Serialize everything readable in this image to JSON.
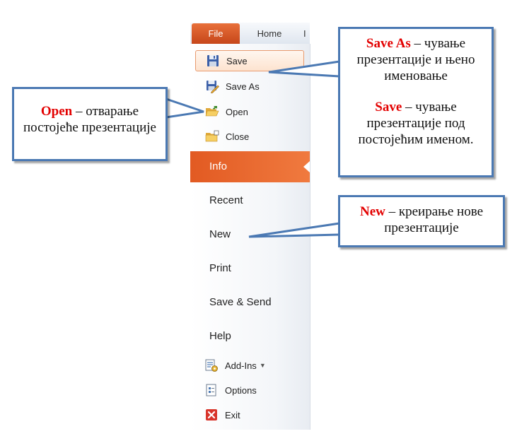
{
  "tabs": {
    "file": "File",
    "home": "Home",
    "partial": "I"
  },
  "commands": {
    "save": "Save",
    "save_as": "Save As",
    "open": "Open",
    "close": "Close"
  },
  "nav": {
    "info": "Info",
    "recent": "Recent",
    "new": "New",
    "print": "Print",
    "save_send": "Save & Send",
    "help": "Help"
  },
  "bottom": {
    "addins": "Add-Ins",
    "options": "Options",
    "exit": "Exit"
  },
  "callouts": {
    "save_as": {
      "term": "Save As",
      "text": " – чување презентације и њено именовање"
    },
    "save": {
      "term": "Save",
      "text": " – чување презентације под постојећим именом."
    },
    "open": {
      "term": "Open",
      "text": " – отварање постојеће презентације"
    },
    "new": {
      "term": "New",
      "text": " – креирање нове презентације"
    }
  },
  "colors": {
    "accent": "#e25a22",
    "callout_border": "#4b79b3",
    "highlight": "#e30000"
  }
}
